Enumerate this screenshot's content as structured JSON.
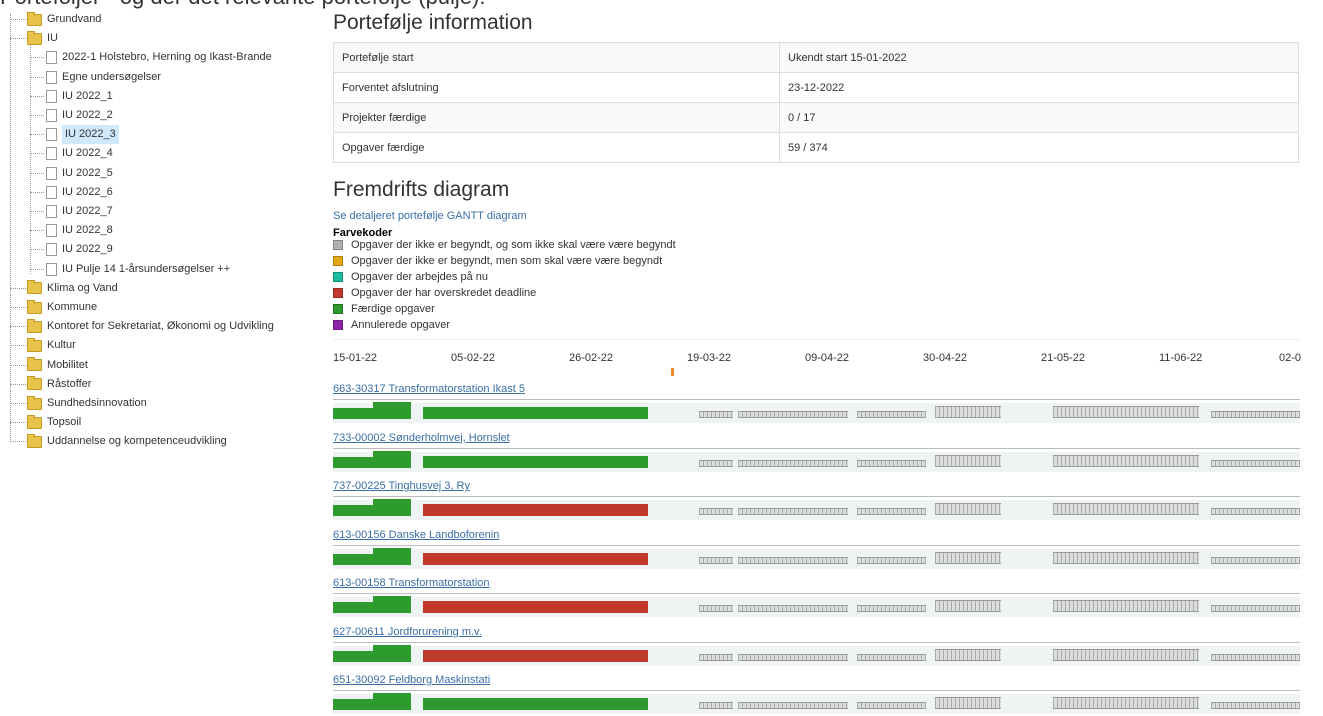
{
  "top_caption": "Portefoljer - og der det relevante portefolje (pulje).",
  "tree": {
    "items": [
      {
        "label": "Grundvand",
        "type": "folder",
        "level": 0
      },
      {
        "label": "IU",
        "type": "folder",
        "level": 0
      },
      {
        "label": "2022-1 Holstebro, Herning og Ikast-Brande",
        "type": "file",
        "level": 1
      },
      {
        "label": "Egne undersøgelser",
        "type": "file",
        "level": 1
      },
      {
        "label": "IU 2022_1",
        "type": "file",
        "level": 1
      },
      {
        "label": "IU 2022_2",
        "type": "file",
        "level": 1
      },
      {
        "label": "IU 2022_3",
        "type": "file",
        "level": 1,
        "selected": true
      },
      {
        "label": "IU 2022_4",
        "type": "file",
        "level": 1
      },
      {
        "label": "IU 2022_5",
        "type": "file",
        "level": 1
      },
      {
        "label": "IU 2022_6",
        "type": "file",
        "level": 1
      },
      {
        "label": "IU 2022_7",
        "type": "file",
        "level": 1
      },
      {
        "label": "IU 2022_8",
        "type": "file",
        "level": 1
      },
      {
        "label": "IU 2022_9",
        "type": "file",
        "level": 1
      },
      {
        "label": "IU Pulje 14 1-årsundersøgelser ++",
        "type": "file",
        "level": 1
      },
      {
        "label": "Klima og Vand",
        "type": "folder",
        "level": 0
      },
      {
        "label": "Kommune",
        "type": "folder",
        "level": 0
      },
      {
        "label": "Kontoret for Sekretariat, Økonomi og Udvikling",
        "type": "folder",
        "level": 0
      },
      {
        "label": "Kultur",
        "type": "folder",
        "level": 0
      },
      {
        "label": "Mobilitet",
        "type": "folder",
        "level": 0
      },
      {
        "label": "Råstoffer",
        "type": "folder",
        "level": 0
      },
      {
        "label": "Sundhedsinnovation",
        "type": "folder",
        "level": 0
      },
      {
        "label": "Topsoil",
        "type": "folder",
        "level": 0
      },
      {
        "label": "Uddannelse og kompetenceudvikling",
        "type": "folder",
        "level": 0
      }
    ]
  },
  "portfolio": {
    "heading": "Portefølje information",
    "rows": [
      {
        "label": "Portefølje start",
        "value": "Ukendt start 15-01-2022"
      },
      {
        "label": "Forventet afslutning",
        "value": "23-12-2022"
      },
      {
        "label": "Projekter færdige",
        "value": "0 / 17"
      },
      {
        "label": "Opgaver færdige",
        "value": "59 / 374"
      }
    ]
  },
  "progress": {
    "heading": "Fremdrifts diagram",
    "gantt_link": "Se detaljeret portefølje GANTT diagram",
    "legend_title": "Farvekoder",
    "legend": [
      {
        "label": "Opgaver der ikke er begyndt, og som ikke skal være være begyndt",
        "color": "#b0b0b0"
      },
      {
        "label": "Opgaver der ikke er begyndt, men som skal være være begyndt",
        "color": "#e6a817"
      },
      {
        "label": "Opgaver der arbejdes på nu",
        "color": "#1abc9c"
      },
      {
        "label": "Opgaver der har overskredet deadline",
        "color": "#c0392b"
      },
      {
        "label": "Færdige opgaver",
        "color": "#2e9b2e"
      },
      {
        "label": "Annulerede opgaver",
        "color": "#8e24aa"
      }
    ],
    "dates": [
      "15-01-22",
      "05-02-22",
      "26-02-22",
      "19-03-22",
      "09-04-22",
      "30-04-22",
      "21-05-22",
      "11-06-22",
      "02-0"
    ],
    "projects": [
      {
        "name": "663-30317 Transformatorstation Ikast 5",
        "second_bar": "done"
      },
      {
        "name": "733-00002 Sønderholmvej, Hornslet",
        "second_bar": "done"
      },
      {
        "name": "737-00225 Tinghusvej 3, Ry",
        "second_bar": "overdue"
      },
      {
        "name": "613-00156 Danske Landboforenin",
        "second_bar": "overdue"
      },
      {
        "name": "613-00158 Transformatorstation",
        "second_bar": "overdue"
      },
      {
        "name": "627-00611 Jordforurening m.v.",
        "second_bar": "overdue"
      },
      {
        "name": "651-30092 Feldborg Maskinstati",
        "second_bar": "done"
      }
    ]
  }
}
